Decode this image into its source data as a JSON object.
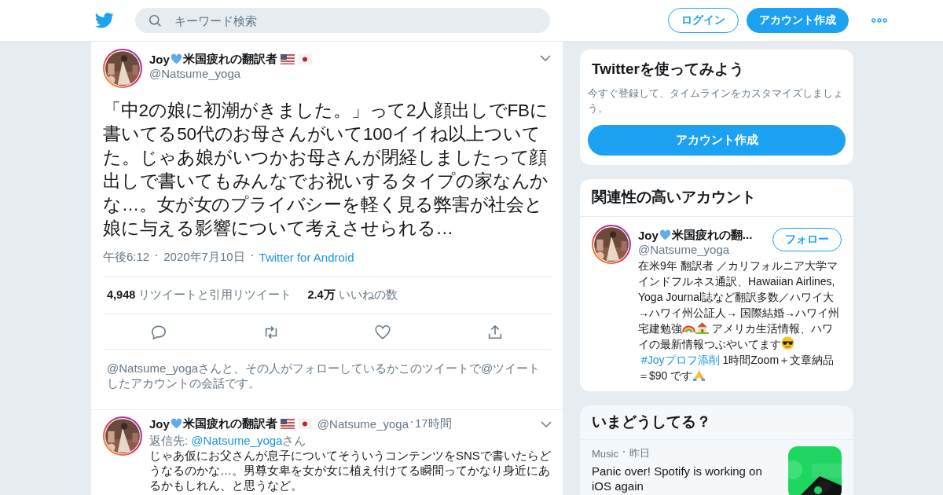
{
  "header": {
    "search": {
      "placeholder": "キーワード検索"
    },
    "login": "ログイン",
    "signup": "アカウント作成"
  },
  "tweet": {
    "author": {
      "name_start": "Joy",
      "name_end": "米国疲れの翻訳者",
      "handle": "@Natsume_yoga"
    },
    "text": "「中2の娘に初潮がきました。」って2人顔出しでFBに書いてる50代のお母さんがいて100イイね以上ついてた。じゃあ娘がいつかお母さんが閉経しましたって顔出しで書いてもみんなでお祝いするタイプの家なんかな…。女が女のプライバシーを軽く見る弊害が社会と娘に与える影響について考えさせられる…",
    "meta": [
      "午後6:12",
      "2020年7月10日"
    ],
    "source": "Twitter for Android",
    "stats": [
      {
        "count": "4,948",
        "label": "リツイートと引用リツイート"
      },
      {
        "count": "2.4万",
        "label": "いいねの数"
      }
    ],
    "conversation_note": "@Natsume_yogaさんと、その人がフォローしているかこのツイートで@ツイートしたアカウントの会話です。"
  },
  "reply": {
    "author": {
      "name_start": "Joy",
      "name_end": "米国疲れの翻訳者",
      "handle": "@Natsume_yoga"
    },
    "time": "17時間",
    "reply_to_label": "返信先: ",
    "reply_to_handle": "@Natsume_yoga",
    "reply_to_suffix": "さん",
    "text": "じゃあ仮にお父さんが息子についてそういうコンテンツをSNSで書いたらどうなるのかな…。男尊女卑を女が女に植え付けてる瞬間ってかなり身近にあるかもしれん、と思うなど。"
  },
  "signup_card": {
    "title": "Twitterを使ってみよう",
    "text": "今すぐ登録して、タイムラインをカスタマイズしましょう。",
    "button": "アカウント作成"
  },
  "related": {
    "title": "関連性の高いアカウント",
    "account": {
      "name_start": "Joy",
      "name_end": "米国疲れの翻...",
      "handle": "@Natsume_yoga",
      "follow": "フォロー",
      "bio": [
        {
          "kind": "text",
          "text": "在米9年 翻訳者 ／カリフォルニア大学マインドフルネス通訳、Hawaiian Airlines, Yoga Journal誌など翻訳多数／ハワイ大→ハワイ州公証人→ 国際結婚→ハワイ州宅建勉強"
        },
        {
          "kind": "rainbow"
        },
        {
          "kind": "house"
        },
        {
          "kind": "text",
          "text": " アメリカ生活情報、ハワイの最新情報つぶやいてます"
        },
        {
          "kind": "sunglasses"
        },
        {
          "kind": "link",
          "text": "#Joyプロフ添削"
        },
        {
          "kind": "text",
          "text": " 1時間Zoom＋文章納品＝$90 です"
        },
        {
          "kind": "hands"
        }
      ]
    }
  },
  "trends": {
    "title": "いまどうしてる？",
    "items": [
      {
        "category": "Music",
        "time": "昨日",
        "headline": "Panic over! Spotify is working on iOS again"
      }
    ]
  }
}
